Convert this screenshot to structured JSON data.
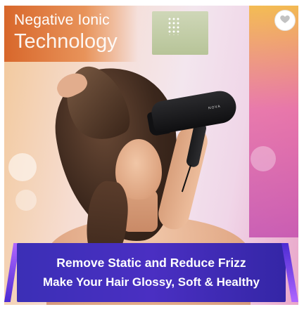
{
  "product_image": {
    "heading_line1": "Negative Ionic",
    "heading_line2": "Technology",
    "dryer_brand_mark": "NOVA",
    "banner_line1": "Remove Static and Reduce Frizz",
    "banner_line2": "Make Your Hair Glossy, Soft & Healthy"
  },
  "wishlist": {
    "icon": "heart-icon"
  },
  "colors": {
    "banner": "#4a2fc2",
    "accent_orange": "#d8672b",
    "accent_pink": "#e76aa2"
  }
}
